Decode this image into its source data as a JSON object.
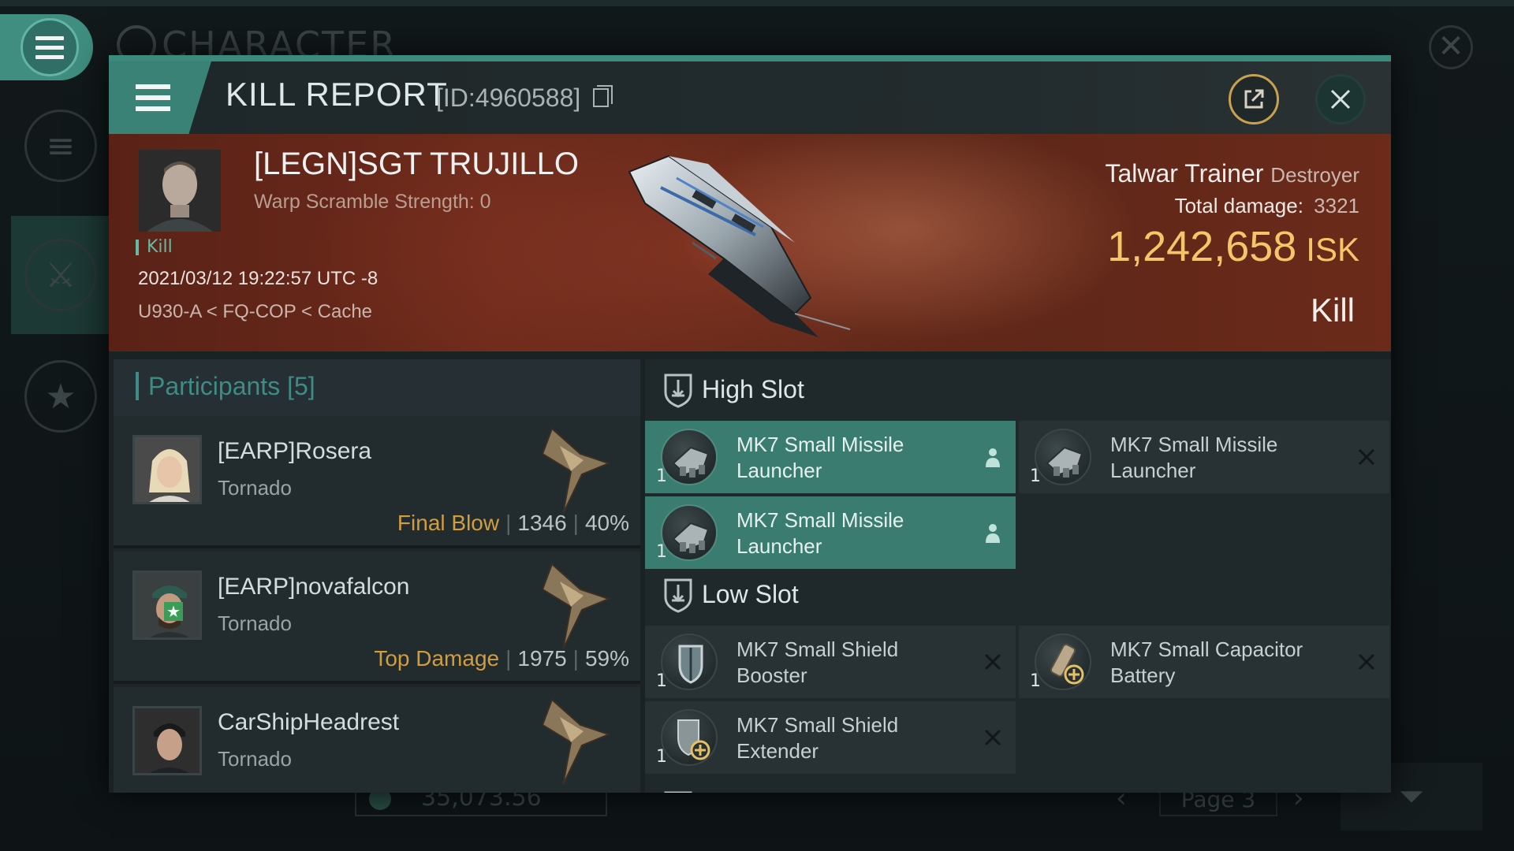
{
  "background": {
    "title": "CHARACTER",
    "wallet_value": "35,073.56",
    "page_label": "Page 3"
  },
  "header": {
    "title": "KILL REPORT",
    "report_id": "[ID:4960588]"
  },
  "victim": {
    "name": "[LEGN]SGT TRUJILLO",
    "warp_scramble": "Warp Scramble Strength: 0",
    "tag": "Kill",
    "timestamp": "2021/03/12 19:22:57 UTC -8",
    "location": "U930-A < FQ-COP < Cache",
    "ship_name": "Talwar Trainer",
    "ship_class": "Destroyer",
    "total_damage_label": "Total damage:",
    "total_damage_value": "3321",
    "isk_value": "1,242,658",
    "isk_unit": "ISK",
    "result": "Kill"
  },
  "participants": {
    "title": "Participants [5]",
    "items": [
      {
        "name": "[EARP]Rosera",
        "ship": "Tornado",
        "tag": "Final Blow",
        "damage": "1346",
        "percent": "40%"
      },
      {
        "name": "[EARP]novafalcon",
        "ship": "Tornado",
        "tag": "Top Damage",
        "damage": "1975",
        "percent": "59%"
      },
      {
        "name": "CarShipHeadrest",
        "ship": "Tornado",
        "tag": "",
        "damage": "",
        "percent": ""
      }
    ]
  },
  "fitting": {
    "high_slot": {
      "label": "High Slot",
      "modules": [
        {
          "name": "MK7 Small Missile Launcher",
          "qty": "1",
          "status": "fitted-person-icon"
        },
        {
          "name": "MK7 Small Missile Launcher",
          "qty": "1",
          "status": "destroyed-x-icon"
        },
        {
          "name": "MK7 Small Missile Launcher",
          "qty": "1",
          "status": "fitted-person-icon"
        }
      ]
    },
    "low_slot": {
      "label": "Low Slot",
      "modules": [
        {
          "name": "MK7 Small Shield Booster",
          "qty": "1",
          "status": "destroyed-x-icon"
        },
        {
          "name": "MK7 Small Capacitor Battery",
          "qty": "1",
          "status": "destroyed-x-icon"
        },
        {
          "name": "MK7 Small Shield Extender",
          "qty": "1",
          "status": "destroyed-x-icon"
        }
      ]
    }
  },
  "colors": {
    "accent": "#3a8275",
    "isk_gold": "#f3c66a",
    "banner_red": "#6d2a1b",
    "tag_orange": "#d19d3f"
  }
}
